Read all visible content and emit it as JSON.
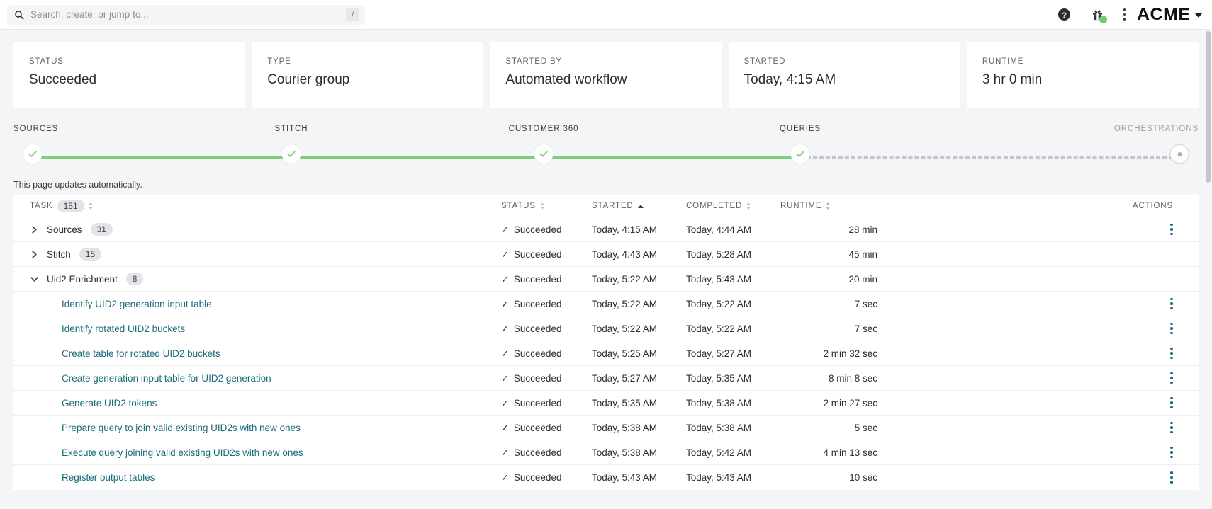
{
  "topbar": {
    "search": {
      "placeholder": "Search, create, or jump to...",
      "value": "",
      "shortcut": "/"
    },
    "help_icon": "help-circle-icon",
    "gift_icon": "gift-icon",
    "overflow_icon": "kebab-menu-icon",
    "brand": "ACME",
    "brand_chevron": "chevron-down-icon"
  },
  "summary_cards": [
    {
      "label": "STATUS",
      "value": "Succeeded"
    },
    {
      "label": "TYPE",
      "value": "Courier group"
    },
    {
      "label": "STARTED BY",
      "value": "Automated workflow"
    },
    {
      "label": "STARTED",
      "value": "Today, 4:15 AM"
    },
    {
      "label": "RUNTIME",
      "value": "3 hr 0 min"
    }
  ],
  "stepper": {
    "steps": [
      {
        "label": "SOURCES",
        "state": "done"
      },
      {
        "label": "STITCH",
        "state": "done"
      },
      {
        "label": "CUSTOMER 360",
        "state": "done"
      },
      {
        "label": "QUERIES",
        "state": "done"
      },
      {
        "label": "ORCHESTRATIONS",
        "state": "pending"
      }
    ],
    "done_color": "#82cc7e",
    "pending_color": "#c3c7cb"
  },
  "auto_update_note": "This page updates automatically.",
  "table": {
    "columns": {
      "task": "TASK",
      "task_count": "151",
      "status": "STATUS",
      "started": "STARTED",
      "completed": "COMPLETED",
      "runtime": "RUNTIME",
      "actions": "ACTIONS"
    },
    "sort": {
      "column": "STARTED",
      "direction": "asc"
    },
    "rows": [
      {
        "kind": "group",
        "expanded": false,
        "name": "Sources",
        "count": "31",
        "status": "Succeeded",
        "started": "Today, 4:15 AM",
        "completed": "Today, 4:44 AM",
        "runtime": "28 min",
        "has_actions": true
      },
      {
        "kind": "group",
        "expanded": false,
        "name": "Stitch",
        "count": "15",
        "status": "Succeeded",
        "started": "Today, 4:43 AM",
        "completed": "Today, 5:28 AM",
        "runtime": "45 min",
        "has_actions": false
      },
      {
        "kind": "group",
        "expanded": true,
        "name": "Uid2 Enrichment",
        "count": "8",
        "status": "Succeeded",
        "started": "Today, 5:22 AM",
        "completed": "Today, 5:43 AM",
        "runtime": "20 min",
        "has_actions": false
      },
      {
        "kind": "task",
        "name": "Identify UID2 generation input table",
        "status": "Succeeded",
        "started": "Today, 5:22 AM",
        "completed": "Today, 5:22 AM",
        "runtime": "7 sec",
        "has_actions": true
      },
      {
        "kind": "task",
        "name": "Identify rotated UID2 buckets",
        "status": "Succeeded",
        "started": "Today, 5:22 AM",
        "completed": "Today, 5:22 AM",
        "runtime": "7 sec",
        "has_actions": true
      },
      {
        "kind": "task",
        "name": "Create table for rotated UID2 buckets",
        "status": "Succeeded",
        "started": "Today, 5:25 AM",
        "completed": "Today, 5:27 AM",
        "runtime": "2 min 32 sec",
        "has_actions": true
      },
      {
        "kind": "task",
        "name": "Create generation input table for UID2 generation",
        "status": "Succeeded",
        "started": "Today, 5:27 AM",
        "completed": "Today, 5:35 AM",
        "runtime": "8 min 8 sec",
        "has_actions": true
      },
      {
        "kind": "task",
        "name": "Generate UID2 tokens",
        "status": "Succeeded",
        "started": "Today, 5:35 AM",
        "completed": "Today, 5:38 AM",
        "runtime": "2 min 27 sec",
        "has_actions": true
      },
      {
        "kind": "task",
        "name": "Prepare query to join valid existing UID2s with new ones",
        "status": "Succeeded",
        "started": "Today, 5:38 AM",
        "completed": "Today, 5:38 AM",
        "runtime": "5 sec",
        "has_actions": true
      },
      {
        "kind": "task",
        "name": "Execute query joining valid existing UID2s with new ones",
        "status": "Succeeded",
        "started": "Today, 5:38 AM",
        "completed": "Today, 5:42 AM",
        "runtime": "4 min 13 sec",
        "has_actions": true
      },
      {
        "kind": "task",
        "name": "Register output tables",
        "status": "Succeeded",
        "started": "Today, 5:43 AM",
        "completed": "Today, 5:43 AM",
        "runtime": "10 sec",
        "has_actions": true
      }
    ]
  },
  "colors": {
    "link": "#1b6b7d",
    "success": "#82cc7e",
    "page_bg": "#f4f5f7"
  }
}
